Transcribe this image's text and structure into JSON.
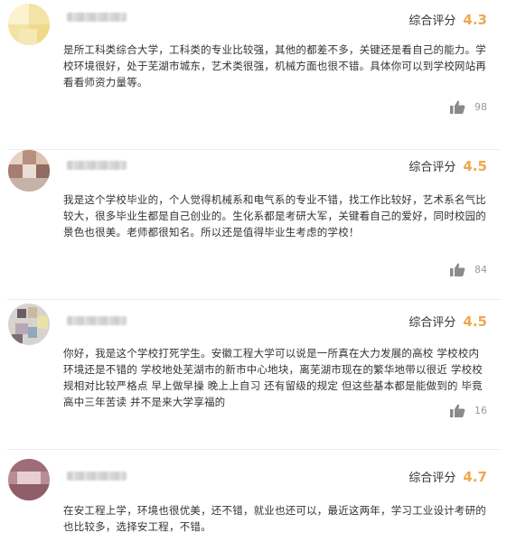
{
  "reviews": [
    {
      "score_label": "综合评分",
      "score": "4.3",
      "text": "是所工科类综合大学，工科类的专业比较强，其他的都差不多，关键还是看自己的能力。学校环境很好，处于芜湖市城东，艺术类很强，机械方面也很不错。具体你可以到学校网站再看看师资力量等。",
      "likes": "98"
    },
    {
      "score_label": "综合评分",
      "score": "4.5",
      "text": "我是这个学校毕业的，个人觉得机械系和电气系的专业不错，找工作比较好，艺术系名气比较大，很多毕业生都是自己创业的。生化系都是考研大军，关键看自己的爱好，同时校园的景色也很美。老师都很知名。所以还是值得毕业生考虑的学校！",
      "likes": "84"
    },
    {
      "score_label": "综合评分",
      "score": "4.5",
      "text": "你好，我是这个学校打死学生。安徽工程大学可以说是一所真在大力发展的高校 学校校内环境还是不错的 学校地处芜湖市的新市中心地块，离芜湖市现在的繁华地带以很近 学校校规相对比较严格点 早上做早操 晚上上自习 还有留级的规定 但这些基本都是能做到的 毕竟高中三年苦读 并不是来大学享福的",
      "likes": "16"
    },
    {
      "score_label": "综合评分",
      "score": "4.7",
      "text": "在安工程上学，环境也很优美，还不错，就业也还可以，最近这两年，学习工业设计考研的也比较多，选择安工程，不错。",
      "likes": ""
    }
  ],
  "colors": {
    "score": "#f0a84e",
    "text": "#333333",
    "muted": "#999999"
  },
  "icons": {
    "like": "thumbs-up-icon"
  }
}
